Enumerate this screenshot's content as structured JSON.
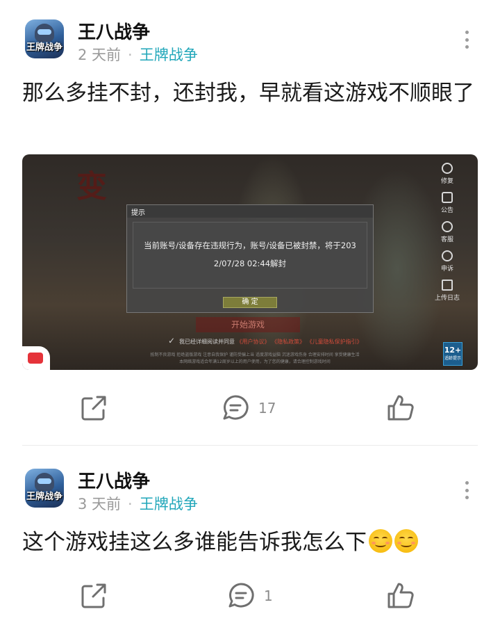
{
  "posts": [
    {
      "username": "王八战争",
      "time": "2 天前",
      "dot": "·",
      "tag": "王牌战争",
      "avatar_text": "王牌战争",
      "content": "那么多挂不封，还封我，早就看这游戏不顺眼了",
      "screenshot": {
        "dialog_title": "提示",
        "dialog_line1": "当前账号/设备存在违规行为，账号/设备已被封禁，将于203",
        "dialog_line2": "2/07/28 02:44解封",
        "confirm_label": "确 定",
        "start_label": "开始游戏",
        "agree_text": "我已经详细阅读并同意",
        "agree_links": [
          "《用户协议》",
          "《隐私政策》",
          "《儿童隐私保护指引》"
        ],
        "fine_print_1": "抵制不良游戏 拒绝盗版游戏 注意自我保护 谨防受骗上当 适度游戏益脑 沉迷游戏伤身 合理安排时间 享受健康生活",
        "fine_print_2": "本网络游戏适合年满12周岁以上的用户使用，为了您的健康，请合理控制游戏时间",
        "age_label": "12+",
        "age_sub": "适龄提示",
        "side_icons": [
          {
            "icon": "wrench-icon",
            "label": "修复"
          },
          {
            "icon": "notice-icon",
            "label": "公告"
          },
          {
            "icon": "service-icon",
            "label": "客服"
          },
          {
            "icon": "appeal-icon",
            "label": "申诉"
          },
          {
            "icon": "upload-icon",
            "label": "上传日志"
          }
        ]
      },
      "share_count": "",
      "comment_count": "17",
      "like_count": ""
    },
    {
      "username": "王八战争",
      "time": "3 天前",
      "dot": "·",
      "tag": "王牌战争",
      "avatar_text": "王牌战争",
      "content": "这个游戏挂这么多谁能告诉我怎么下",
      "emojis": [
        "smiling-face-icon",
        "smiling-face-icon"
      ],
      "comment_count": "1"
    }
  ],
  "colors": {
    "tag": "#1fa6b9",
    "muted": "#9a9a9a",
    "icon_stroke": "#6f6f6f"
  }
}
